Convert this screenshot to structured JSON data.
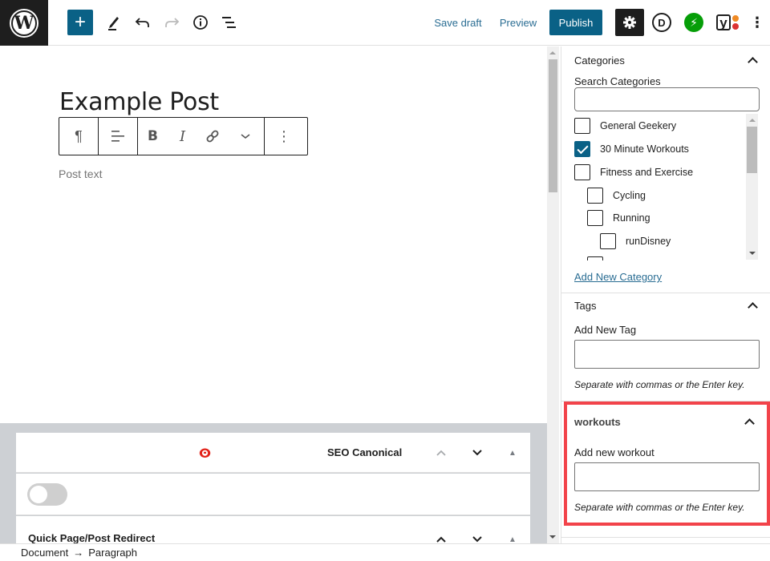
{
  "header": {
    "logo": "wordpress-logo",
    "add_block_label": "+",
    "icons": {
      "add": "plus-icon",
      "tools": "pencil-icon",
      "undo": "undo-icon",
      "redo": "redo-icon",
      "details": "info-icon",
      "list_view": "list-view-icon"
    },
    "save_draft": "Save draft",
    "preview": "Preview",
    "publish": "Publish",
    "plugins": [
      "settings-gear",
      "divi",
      "jetpack",
      "yoast-seo"
    ],
    "divi_letter": "D",
    "yoast_letter": "y",
    "colors": {
      "accent": "#0a6186",
      "jetpack": "#069e08",
      "yoast_orange": "#f08a24",
      "yoast_red": "#dc3232"
    }
  },
  "editor": {
    "title": "Example Post",
    "block_toolbar": {
      "paragraph": "¶",
      "align": "align-left-icon",
      "bold": "B",
      "italic": "I",
      "link": "link-icon",
      "more_formats": "chevron-down-icon",
      "options": "⋮"
    },
    "paragraph_placeholder": "Post text"
  },
  "meta_boxes": [
    {
      "title": "SEO Canonical",
      "move_up_disabled": true
    },
    {
      "toggle_on": false
    },
    {
      "title": "Quick Page/Post Redirect",
      "move_up_disabled": false
    }
  ],
  "breadcrumb": {
    "items": [
      "Document",
      "Paragraph"
    ],
    "separator": "→"
  },
  "sidebar": {
    "categories": {
      "title": "Categories",
      "search_label": "Search Categories",
      "search_value": "",
      "items": [
        {
          "label": "General Geekery",
          "checked": false,
          "level": 0
        },
        {
          "label": "30 Minute Workouts",
          "checked": true,
          "level": 0
        },
        {
          "label": "Fitness and Exercise",
          "checked": false,
          "level": 0
        },
        {
          "label": "Cycling",
          "checked": false,
          "level": 1
        },
        {
          "label": "Running",
          "checked": false,
          "level": 1
        },
        {
          "label": "runDisney",
          "checked": false,
          "level": 2
        }
      ],
      "add_new_link": "Add New Category"
    },
    "tags": {
      "title": "Tags",
      "input_label": "Add New Tag",
      "input_value": "",
      "help": "Separate with commas or the Enter key."
    },
    "workouts": {
      "title": "workouts",
      "input_label": "Add new workout",
      "input_value": "",
      "help": "Separate with commas or the Enter key.",
      "highlight_color": "#f2434a"
    }
  }
}
